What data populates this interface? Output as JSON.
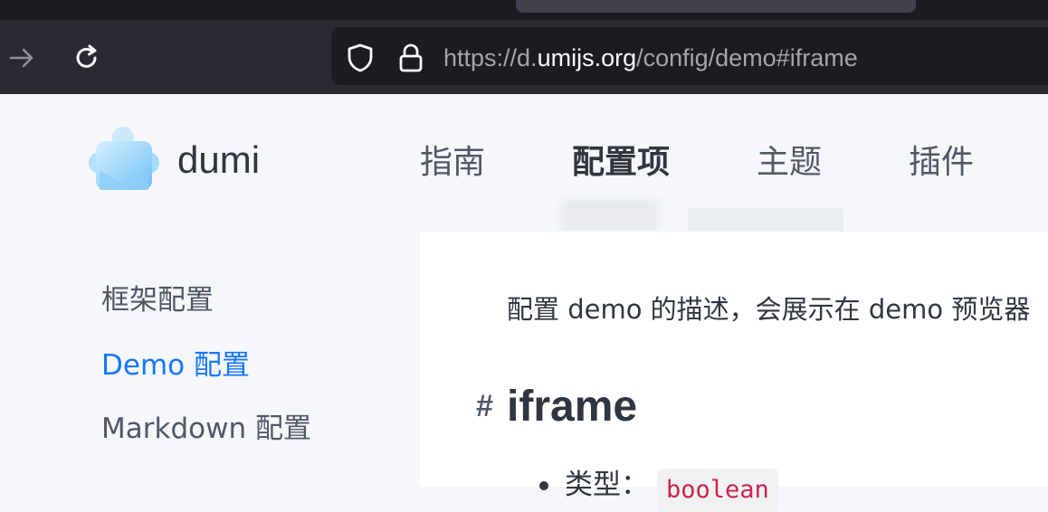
{
  "browser": {
    "url_prefix": "https://d.",
    "url_host": "umijs.org",
    "url_path": "/config/demo#iframe",
    "icons": [
      "forward-arrow-icon",
      "reload-icon",
      "shield-icon",
      "lock-icon"
    ]
  },
  "header": {
    "brand": "dumi",
    "nav": [
      {
        "label": "指南"
      },
      {
        "label": "配置项"
      },
      {
        "label": "主题"
      },
      {
        "label": "插件"
      }
    ]
  },
  "sidebar": {
    "items": [
      {
        "label": "框架配置"
      },
      {
        "label": "Demo 配置"
      },
      {
        "label": "Markdown 配置"
      }
    ]
  },
  "content": {
    "description": "配置 demo 的描述，会展示在 demo 预览器",
    "anchor": "#",
    "heading": "iframe",
    "type_label": "类型：",
    "type_value": "boolean"
  },
  "colors": {
    "accent": "#1677ff",
    "text": "#30363f",
    "chrome": "#2b2a33"
  }
}
